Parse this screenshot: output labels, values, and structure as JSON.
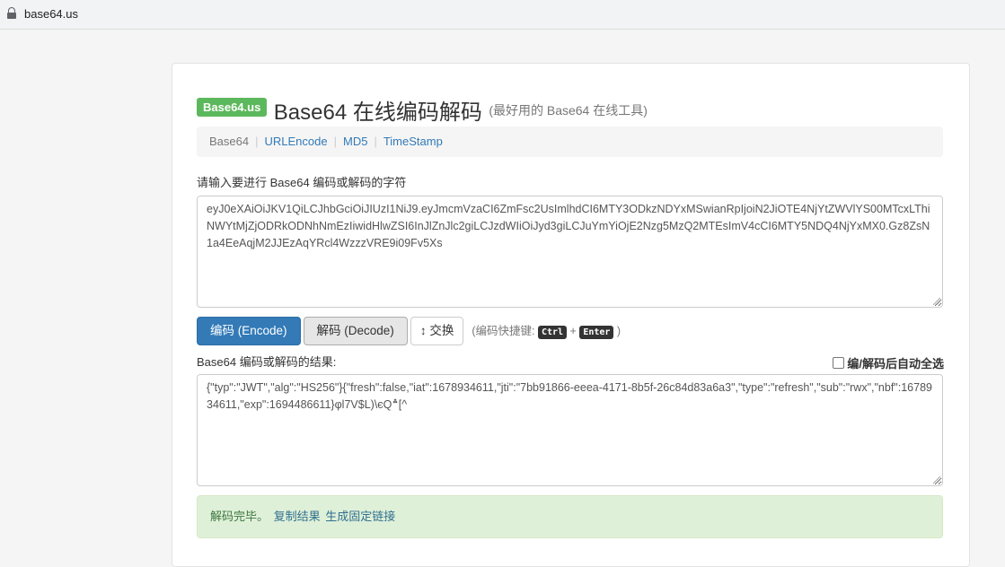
{
  "browser": {
    "url": "base64.us"
  },
  "header": {
    "badge": "Base64.us",
    "title": "Base64 在线编码解码",
    "subtitle": "(最好用的 Base64 在线工具)"
  },
  "nav": {
    "items": [
      {
        "label": "Base64",
        "active": true
      },
      {
        "label": "URLEncode",
        "active": false
      },
      {
        "label": "MD5",
        "active": false
      },
      {
        "label": "TimeStamp",
        "active": false
      }
    ],
    "separator": "|"
  },
  "input": {
    "label": "请输入要进行 Base64 编码或解码的字符",
    "value": "eyJ0eXAiOiJKV1QiLCJhbGciOiJIUzI1NiJ9.eyJmcmVzaCI6ZmFsc2UsImlhdCI6MTY3ODkzNDYxMSwianRpIjoiN2JiOTE4NjYtZWVlYS00MTcxLThiNWYtMjZjODRkODNhNmEzIiwidHlwZSI6InJlZnJlc2giLCJzdWIiOiJyd3giLCJuYmYiOjE2Nzg5MzQ2MTEsImV4cCI6MTY5NDQ4NjYxMX0.Gz8ZsN1a4EeAqjM2JJEzAqYRcl4WzzzVRE9i09Fv5Xs"
  },
  "buttons": {
    "encode": "编码 (Encode)",
    "decode": "解码 (Decode)",
    "swap": "↕ 交换"
  },
  "shortcut": {
    "prefix": "(编码快捷键:",
    "key1": "Ctrl",
    "plus": "+",
    "key2": "Enter",
    "suffix": ")"
  },
  "output": {
    "label": "Base64 编码或解码的结果:",
    "auto_select_label": "编/解码后自动全选",
    "auto_select_checked": false,
    "value": "{\"typ\":\"JWT\",\"alg\":\"HS256\"}{\"fresh\":false,\"iat\":1678934611,\"jti\":\"7bb91866-eeea-4171-8b5f-26c84d83a6a3\",\"type\":\"refresh\",\"sub\":\"rwx\",\"nbf\":1678934611,\"exp\":1694486611}\u0019φl7V\u0013\u0012$L)\\єQ؞\u0004[^"
  },
  "status": {
    "message": "解码完毕。",
    "copy_link": "复制结果",
    "permalink": "生成固定链接"
  },
  "colors": {
    "badge": "#5cb85c",
    "primary": "#337ab7",
    "alert_bg": "#dff0d8",
    "alert_text": "#3c763d",
    "link": "#337ab7"
  }
}
